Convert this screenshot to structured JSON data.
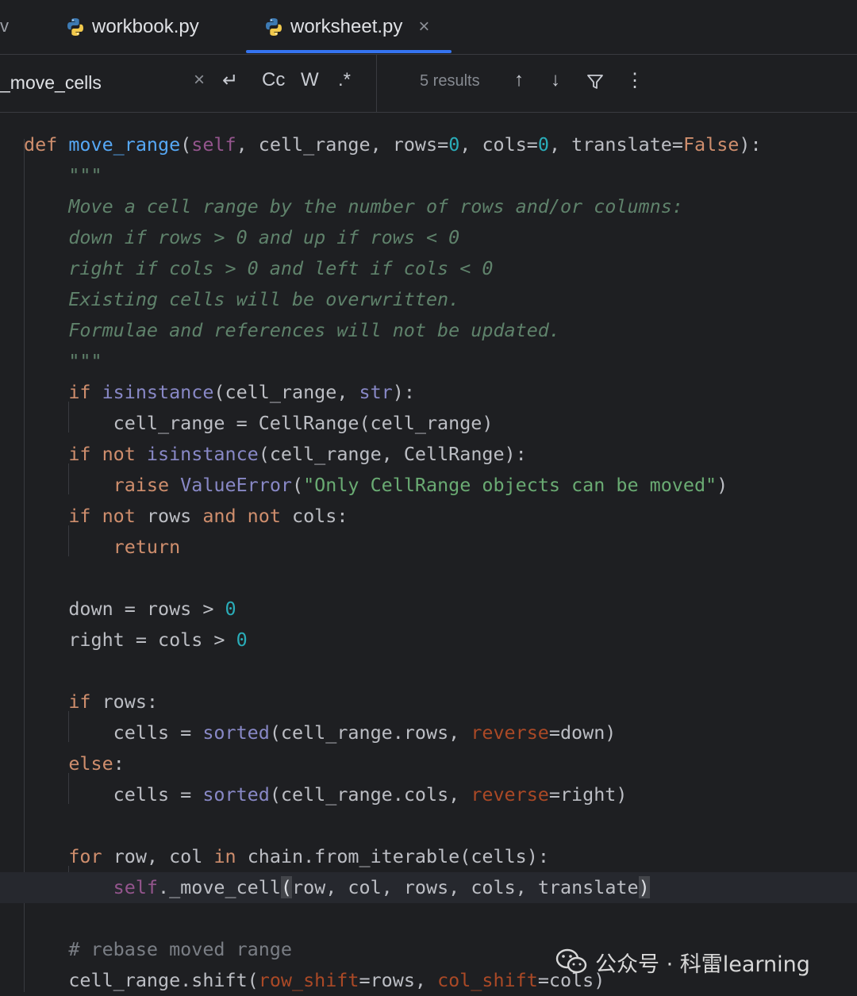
{
  "tabs": [
    {
      "label": "workbook.py"
    },
    {
      "label": "worksheet.py",
      "close": "×"
    }
  ],
  "tabbar": {
    "edge_glyph": "v"
  },
  "search": {
    "query": "_move_cells",
    "clear": "×",
    "newline_option": "↵",
    "match_case": "Cc",
    "whole_words": "W",
    "regex": ".*",
    "results": "5 results",
    "prev": "↑",
    "next": "↓",
    "filter": "filter",
    "more": "⋮"
  },
  "code": {
    "lines": [
      [
        [
          "kw",
          "def "
        ],
        [
          "fn",
          "move_range"
        ],
        [
          "plain",
          "("
        ],
        [
          "self",
          "self"
        ],
        [
          "plain",
          ", cell_range, rows="
        ],
        [
          "num",
          "0"
        ],
        [
          "plain",
          ", cols="
        ],
        [
          "num",
          "0"
        ],
        [
          "plain",
          ", translate="
        ],
        [
          "kw",
          "False"
        ],
        [
          "plain",
          "):"
        ]
      ],
      [
        [
          "doc",
          "    \"\"\""
        ]
      ],
      [
        [
          "doc",
          "    Move a cell range by the number of rows and/or columns:"
        ]
      ],
      [
        [
          "doc",
          "    down if rows > 0 and up if rows < 0"
        ]
      ],
      [
        [
          "doc",
          "    right if cols > 0 and left if cols < 0"
        ]
      ],
      [
        [
          "doc",
          "    Existing cells will be overwritten."
        ]
      ],
      [
        [
          "doc",
          "    Formulae and references will not be updated."
        ]
      ],
      [
        [
          "doc",
          "    \"\"\""
        ]
      ],
      [
        [
          "plain",
          "    "
        ],
        [
          "kw",
          "if "
        ],
        [
          "builtin",
          "isinstance"
        ],
        [
          "plain",
          "(cell_range, "
        ],
        [
          "builtin",
          "str"
        ],
        [
          "plain",
          "):"
        ]
      ],
      [
        [
          "plain",
          "        cell_range = CellRange(cell_range)"
        ]
      ],
      [
        [
          "plain",
          "    "
        ],
        [
          "kw",
          "if not "
        ],
        [
          "builtin",
          "isinstance"
        ],
        [
          "plain",
          "(cell_range, CellRange):"
        ]
      ],
      [
        [
          "plain",
          "        "
        ],
        [
          "kw",
          "raise "
        ],
        [
          "builtin",
          "ValueError"
        ],
        [
          "plain",
          "("
        ],
        [
          "str",
          "\"Only CellRange objects can be moved\""
        ],
        [
          "plain",
          ")"
        ]
      ],
      [
        [
          "plain",
          "    "
        ],
        [
          "kw",
          "if not "
        ],
        [
          "plain",
          "rows "
        ],
        [
          "kw",
          "and not "
        ],
        [
          "plain",
          "cols:"
        ]
      ],
      [
        [
          "plain",
          "        "
        ],
        [
          "kw",
          "return"
        ]
      ],
      [
        [
          "plain",
          ""
        ]
      ],
      [
        [
          "plain",
          "    down = rows > "
        ],
        [
          "num",
          "0"
        ]
      ],
      [
        [
          "plain",
          "    right = cols > "
        ],
        [
          "num",
          "0"
        ]
      ],
      [
        [
          "plain",
          ""
        ]
      ],
      [
        [
          "plain",
          "    "
        ],
        [
          "kw",
          "if "
        ],
        [
          "plain",
          "rows:"
        ]
      ],
      [
        [
          "plain",
          "        cells = "
        ],
        [
          "builtin",
          "sorted"
        ],
        [
          "plain",
          "(cell_range.rows, "
        ],
        [
          "param",
          "reverse"
        ],
        [
          "plain",
          "=down)"
        ]
      ],
      [
        [
          "plain",
          "    "
        ],
        [
          "kw",
          "else"
        ],
        [
          "plain",
          ":"
        ]
      ],
      [
        [
          "plain",
          "        cells = "
        ],
        [
          "builtin",
          "sorted"
        ],
        [
          "plain",
          "(cell_range.cols, "
        ],
        [
          "param",
          "reverse"
        ],
        [
          "plain",
          "=right)"
        ]
      ],
      [
        [
          "plain",
          ""
        ]
      ],
      [
        [
          "plain",
          "    "
        ],
        [
          "kw",
          "for "
        ],
        [
          "plain",
          "row, col "
        ],
        [
          "kw",
          "in "
        ],
        [
          "plain",
          "chain.from_iterable(cells):"
        ]
      ],
      [
        [
          "plain",
          "        "
        ],
        [
          "self",
          "self"
        ],
        [
          "plain",
          "._move_cell"
        ],
        [
          "caret",
          "("
        ],
        [
          "plain",
          "row, col, rows, cols, translate"
        ],
        [
          "caret",
          ")"
        ]
      ],
      [
        [
          "plain",
          ""
        ]
      ],
      [
        [
          "cmt",
          "    # rebase moved range"
        ]
      ],
      [
        [
          "plain",
          "    cell_range.shift("
        ],
        [
          "param",
          "row_shift"
        ],
        [
          "plain",
          "=rows, "
        ],
        [
          "param",
          "col_shift"
        ],
        [
          "plain",
          "=cols)"
        ]
      ]
    ]
  },
  "watermark": {
    "text": "公众号 · 科雷learning"
  },
  "colors": {
    "background": "#1e1f22",
    "keyword": "#cf8e6d",
    "function": "#56a8f5",
    "docstring": "#5f826b",
    "string": "#6aab73",
    "number": "#2aacb8",
    "accent": "#3574f0"
  }
}
